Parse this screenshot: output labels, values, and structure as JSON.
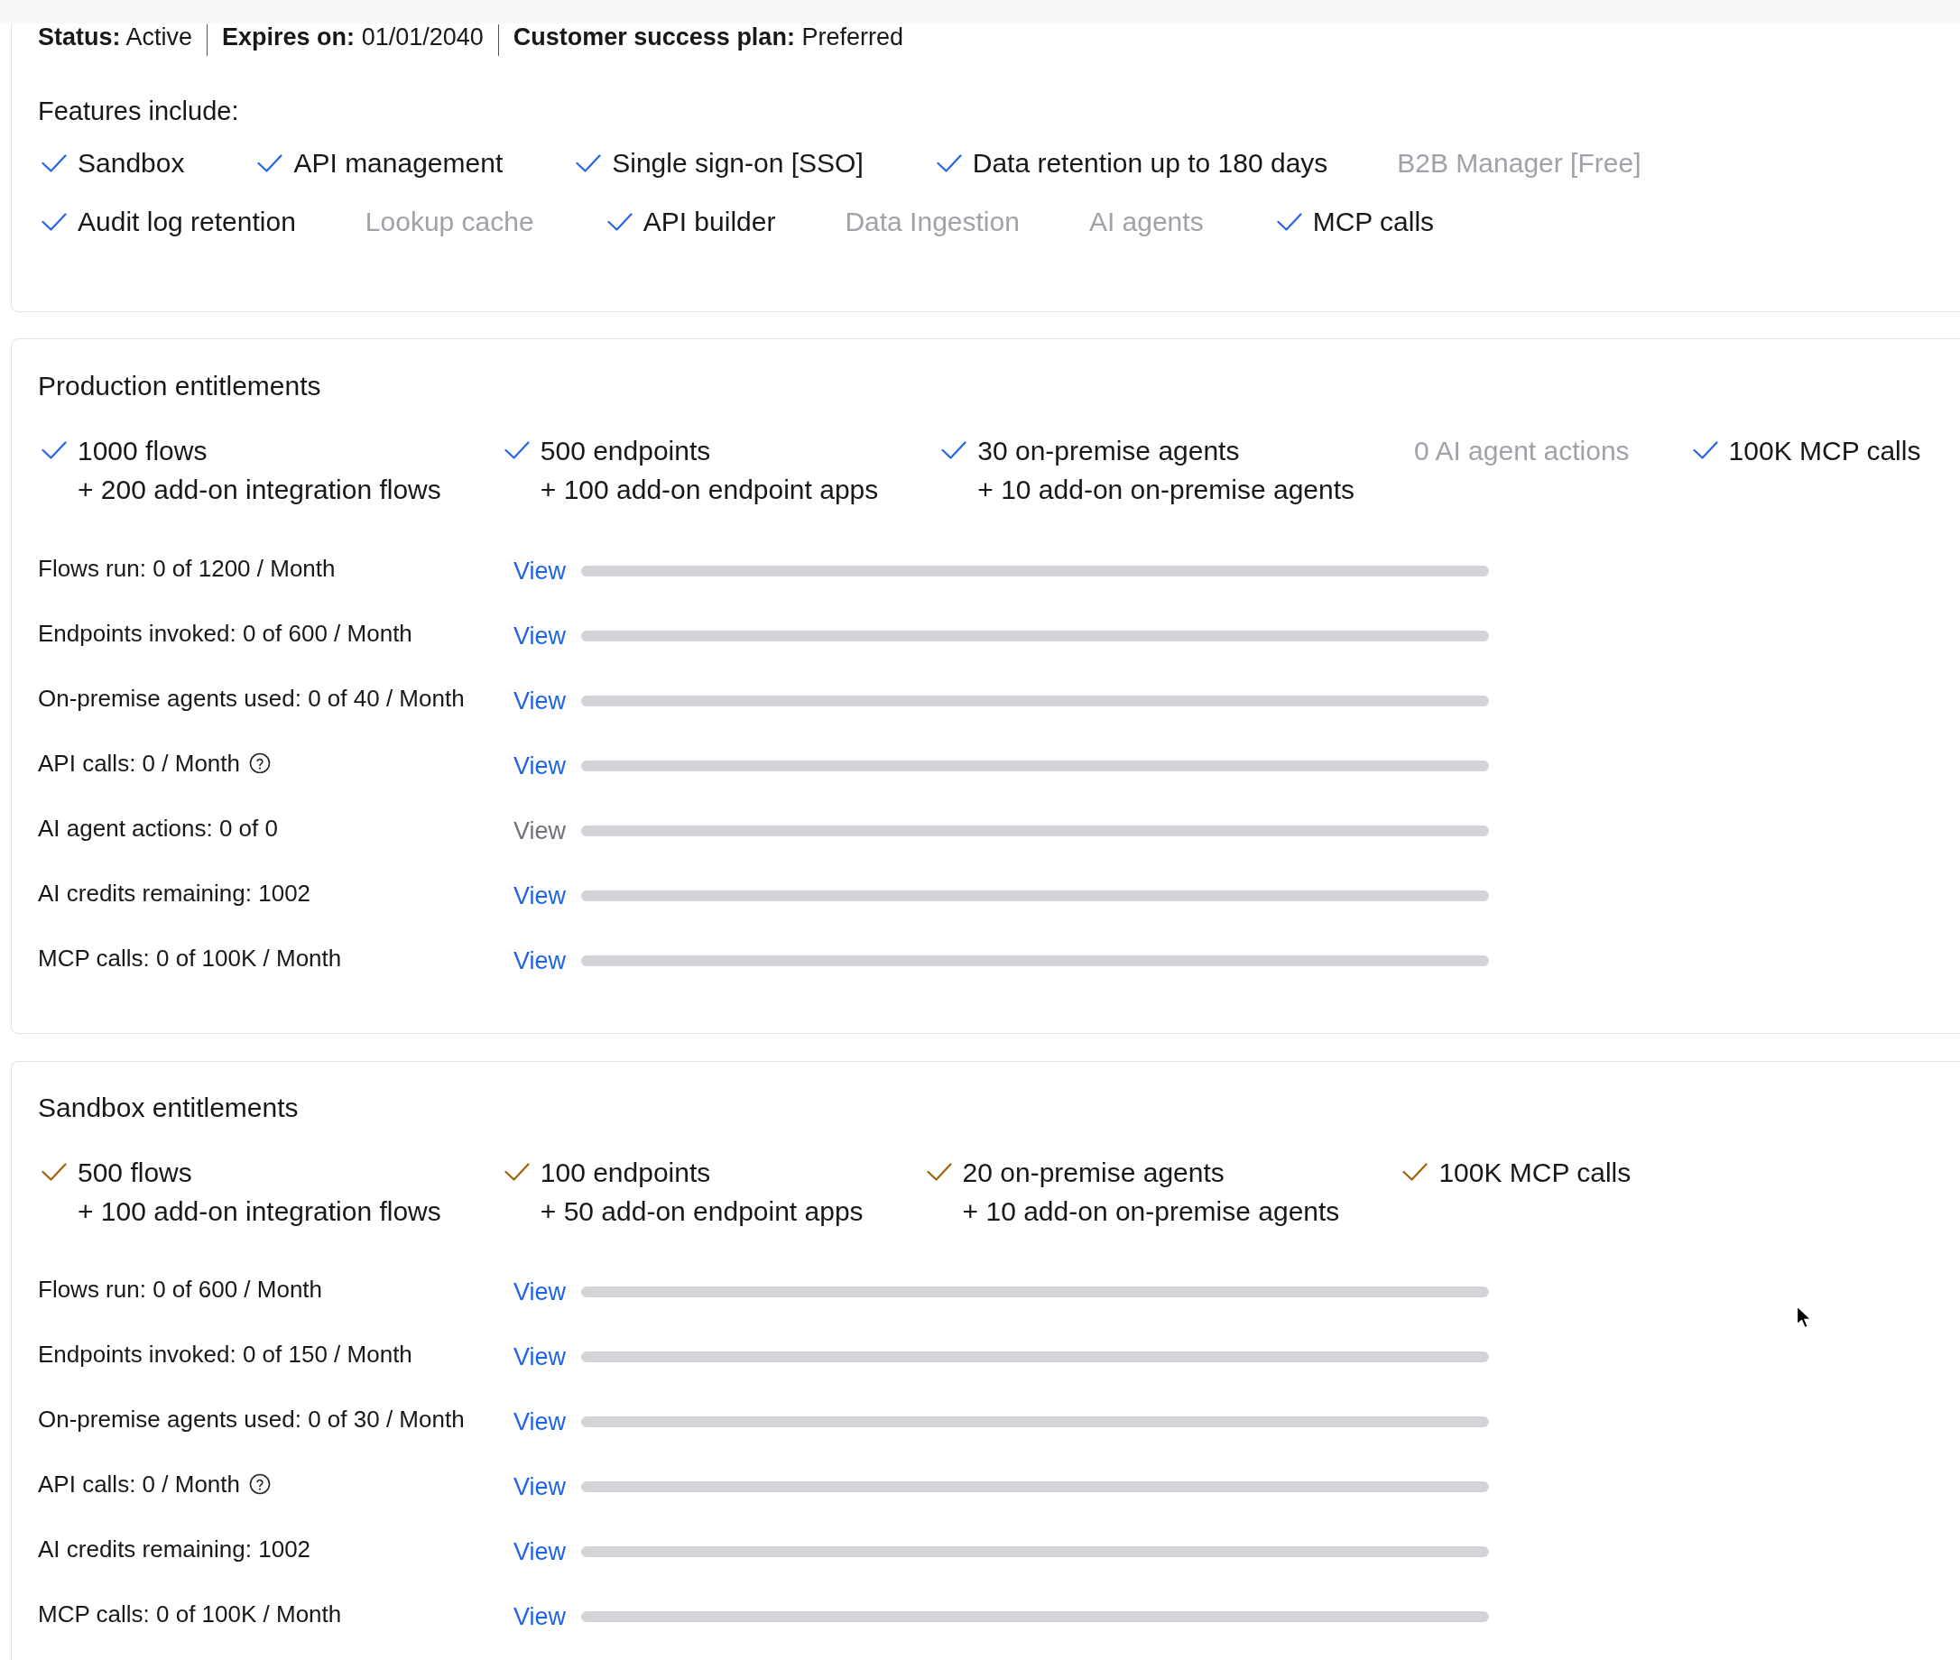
{
  "plan_summary": [
    {
      "label": "Status:",
      "value": "Active"
    },
    {
      "label": "Expires on:",
      "value": "01/01/2040"
    },
    {
      "label": "Customer success plan:",
      "value": "Preferred"
    }
  ],
  "features": {
    "heading": "Features include:",
    "rows": [
      {
        "items": [
          {
            "label": "Sandbox",
            "included": true
          },
          {
            "label": "API management",
            "included": true
          },
          {
            "label": "Single sign-on [SSO]",
            "included": true
          },
          {
            "label": "Data retention up to 180 days",
            "included": true
          },
          {
            "label": "B2B Manager [Free]",
            "included": false
          }
        ]
      },
      {
        "items": [
          {
            "label": "Audit log retention",
            "included": true
          },
          {
            "label": "Lookup cache",
            "included": false
          },
          {
            "label": "API builder",
            "included": true
          },
          {
            "label": "Data Ingestion",
            "included": false
          },
          {
            "label": "AI agents",
            "included": false
          },
          {
            "label": "MCP calls",
            "included": true
          }
        ]
      }
    ]
  },
  "sections": [
    {
      "title": "Production entitlements",
      "color": "#2563eb",
      "entitlements": [
        {
          "name": "1000 flows",
          "addon": "+ 200 add-on integration flows",
          "included": true
        },
        {
          "name": "500 endpoints",
          "addon": "+ 100 add-on endpoint apps",
          "included": true
        },
        {
          "name": "30 on-premise agents",
          "addon": "+ 10 add-on on-premise agents",
          "included": true
        },
        {
          "name": "0 AI agent actions",
          "included": false
        },
        {
          "name": "100K MCP calls",
          "included": true
        }
      ],
      "meters": [
        {
          "label": "Flows run: 0 of 1200 / Month",
          "link": "View",
          "disabled": false,
          "help_icon": false,
          "level": 0
        },
        {
          "label": "Endpoints invoked: 0 of 600 / Month",
          "link": "View",
          "disabled": false,
          "help_icon": false,
          "level": 0
        },
        {
          "label": "On-premise agents used: 0 of 40 / Month",
          "link": "View",
          "disabled": false,
          "help_icon": false,
          "level": 0
        },
        {
          "label": "API calls: 0 / Month",
          "link": "View",
          "disabled": false,
          "help_icon": true,
          "level": 0
        },
        {
          "label": "AI agent actions: 0 of 0",
          "link": "View",
          "disabled": true,
          "help_icon": false,
          "level": 0
        },
        {
          "label": "AI credits remaining: 1002",
          "link": "View",
          "disabled": false,
          "help_icon": false,
          "level": 0
        },
        {
          "label": "MCP calls: 0 of 100K / Month",
          "link": "View",
          "disabled": false,
          "help_icon": false,
          "level": 0
        }
      ]
    },
    {
      "title": "Sandbox entitlements",
      "color": "#a16207",
      "entitlements": [
        {
          "name": "500 flows",
          "addon": "+ 100 add-on integration flows",
          "included": true
        },
        {
          "name": "100 endpoints",
          "addon": "+ 50 add-on endpoint apps",
          "included": true
        },
        {
          "name": "20 on-premise agents",
          "addon": "+ 10 add-on on-premise agents",
          "included": true
        },
        {
          "name": "100K MCP calls",
          "included": true
        }
      ],
      "meters": [
        {
          "label": "Flows run: 0 of 600 / Month",
          "link": "View",
          "disabled": false,
          "help_icon": false,
          "level": 0
        },
        {
          "label": "Endpoints invoked: 0 of 150 / Month",
          "link": "View",
          "disabled": false,
          "help_icon": false,
          "level": 0
        },
        {
          "label": "On-premise agents used: 0 of 30 / Month",
          "link": "View",
          "disabled": false,
          "help_icon": false,
          "level": 0
        },
        {
          "label": "API calls: 0 / Month",
          "link": "View",
          "disabled": false,
          "help_icon": true,
          "level": 0
        },
        {
          "label": "AI credits remaining: 1002",
          "link": "View",
          "disabled": false,
          "help_icon": false,
          "level": 0
        },
        {
          "label": "MCP calls: 0 of 100K / Month",
          "link": "View",
          "disabled": false,
          "help_icon": false,
          "level": 0
        }
      ]
    }
  ]
}
